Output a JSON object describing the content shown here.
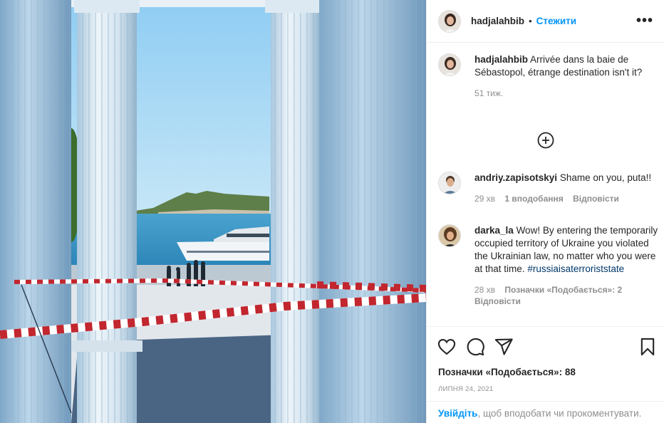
{
  "post": {
    "author": "hadjalahbib",
    "separator": "•",
    "follow_label": "Стежити",
    "more_icon": "more-options-icon",
    "caption": {
      "user": "hadjalahbib",
      "text": "Arrivée dans la baie de Sébastopol, étrange destination isn't it?",
      "age": "51 тиж."
    },
    "load_more_icon": "plus-circle-icon"
  },
  "comments": [
    {
      "user": "andriy.zapisotskyi",
      "text": "Shame on you, puta!!",
      "age": "29 хв",
      "likes": "1 вподобання",
      "reply": "Відповісти"
    },
    {
      "user": "darka_la",
      "text": "Wow! By entering the temporarily occupied territory of Ukraine you violated the Ukrainian law, no matter who you were at that time.",
      "hashtag": "#russiaisaterroriststate",
      "age": "28 хв",
      "likes": "Позначки «Подобається»: 2",
      "reply": "Відповісти"
    }
  ],
  "actions": {
    "like_icon": "heart-icon",
    "comment_icon": "comment-icon",
    "share_icon": "share-icon",
    "save_icon": "bookmark-icon",
    "likes_text": "Позначки «Подобається»: 88",
    "date": "ЛИПНЯ 24, 2021"
  },
  "login_prompt": {
    "link": "Увійдіть",
    "text": ", щоб вподобати чи прокоментувати."
  },
  "colors": {
    "accent": "#0095f6",
    "text": "#262626",
    "secondary": "#8e8e8e",
    "hashtag": "#00376b"
  }
}
